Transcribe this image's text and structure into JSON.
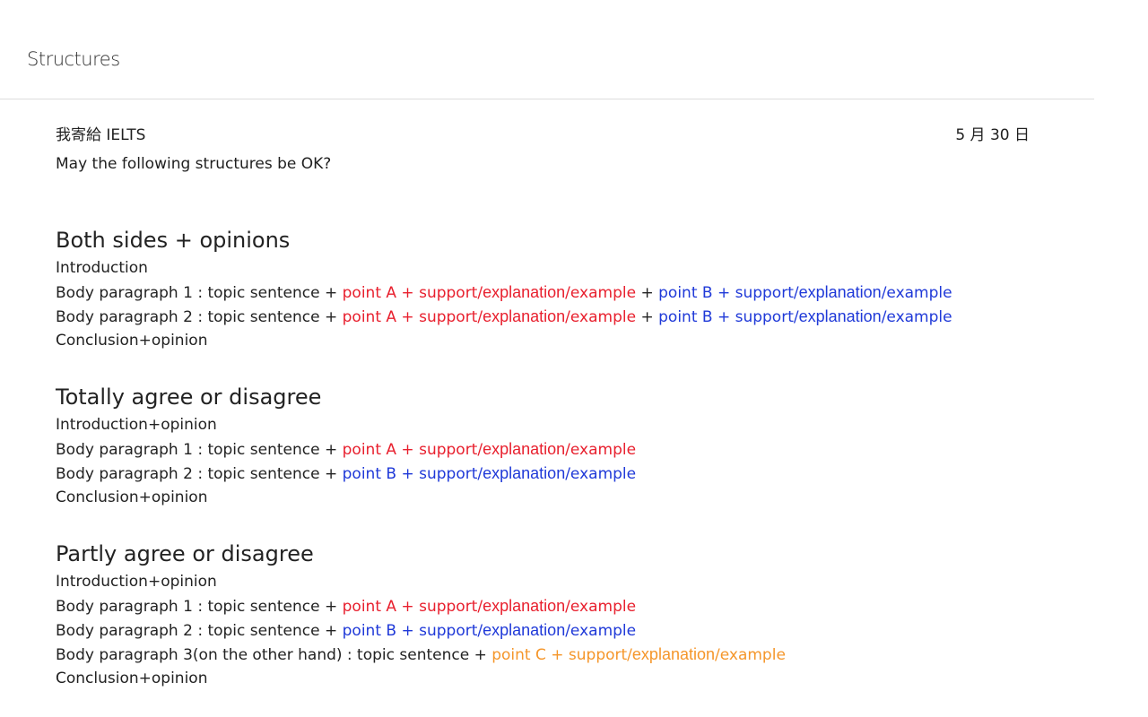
{
  "header": {
    "title": "Structures"
  },
  "message": {
    "sender": "我寄給 IELTS",
    "date": "5 月 30 日",
    "intro": "May the following structures be OK?"
  },
  "colors": {
    "red": "#e8202e",
    "blue": "#1f39d8",
    "orange": "#f5962a"
  },
  "sections": [
    {
      "title": "Both sides + opinions",
      "intro": "Introduction",
      "body1": {
        "prefix": "Body paragraph 1 : topic sentence + ",
        "a": {
          "point": "point A + support/",
          "emph": "explanation",
          "tail": "/example"
        },
        "joiner": " + ",
        "b": {
          "point": "point B + support/",
          "emph": "explanation",
          "tail": "/example"
        }
      },
      "body2": {
        "prefix": "Body paragraph 2 : topic sentence + ",
        "a": {
          "point": "point A + support/",
          "emph": "explanation",
          "tail": "/example"
        },
        "joiner": " + ",
        "b": {
          "point": "point B + support/",
          "emph": "explanation",
          "tail": "/example"
        }
      },
      "conclusion": "Conclusion+opinion"
    },
    {
      "title": "Totally agree or disagree",
      "intro": "Introduction+opinion",
      "body1": {
        "prefix": "Body paragraph 1 : topic sentence + ",
        "a": {
          "point": "point A + support/",
          "emph": "explanation",
          "tail": "/example"
        }
      },
      "body2": {
        "prefix": "Body paragraph 2 : topic sentence + ",
        "b": {
          "point": "point B + support/",
          "emph": "explanation",
          "tail": "/example"
        }
      },
      "conclusion": "Conclusion+opinion"
    },
    {
      "title": "Partly agree or disagree",
      "intro": "Introduction+opinion",
      "body1": {
        "prefix": "Body paragraph 1 : topic sentence + ",
        "a": {
          "point": "point A + support/",
          "emph": "explanation",
          "tail": "/example"
        }
      },
      "body2": {
        "prefix": "Body paragraph 2 : topic sentence + ",
        "b": {
          "point": "point B + support/",
          "emph": "explanation",
          "tail": "/example"
        }
      },
      "body3": {
        "prefix": "Body paragraph 3(on the other hand) : topic sentence + ",
        "c": {
          "point": "point C + support/",
          "emph": "explanation",
          "tail": "/example"
        }
      },
      "conclusion": "Conclusion+opinion"
    }
  ]
}
